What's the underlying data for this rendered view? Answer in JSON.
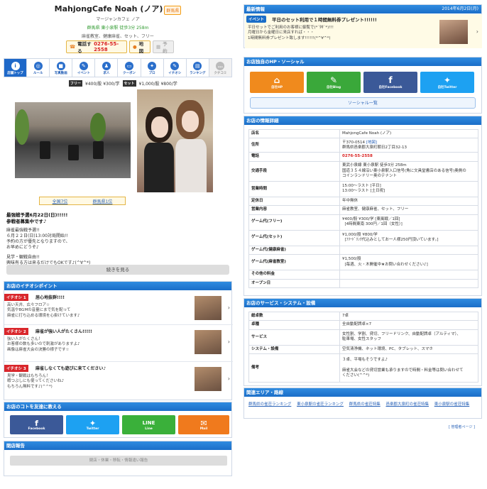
{
  "header": {
    "name": "MahjongCafe Noah (ノア)",
    "area_badge": "群馬県",
    "kana": "マージャンカフェ ノア",
    "address": "群馬県 東小泉駅 徒歩3分 258m",
    "genres": "麻雀教室、健康麻雀、セット、フリー",
    "tel_label": "電話する",
    "tel": "0276-55-2558",
    "map_label": "地図",
    "reserve_label": "予約"
  },
  "nav": [
    {
      "label": "店舗トップ",
      "icon": "i"
    },
    {
      "label": "ルール",
      "icon": "◎"
    },
    {
      "label": "写真動画",
      "icon": "■"
    },
    {
      "label": "イベント",
      "icon": "✎"
    },
    {
      "label": "求人",
      "icon": "♟"
    },
    {
      "label": "クーポン",
      "icon": "▭"
    },
    {
      "label": "プロ",
      "icon": "✦"
    },
    {
      "label": "イチオシ",
      "icon": "✎"
    },
    {
      "label": "ランキング",
      "icon": "▤"
    },
    {
      "label": "クチコミ",
      "icon": "…"
    }
  ],
  "prices": {
    "free_tag": "フリー",
    "free_price": "¥400/股 ¥300/学",
    "set_tag": "セット",
    "set_price": "¥1,000/股 ¥800/学"
  },
  "ranking": {
    "national": "全国7位",
    "prefecture": "群馬県1位"
  },
  "notice": {
    "headline1": "最強戦予選6月22日(日)!!!!!",
    "headline2": "参戦者募集中です♪",
    "line1": "麻雀最強戦予選!!",
    "line2": "６月２２日(日)13:00対局開始!!",
    "line3": "予約の方が優先となりますので、",
    "line4": "お早めにどうぞ♪",
    "line5": "見学・観戦自由!!",
    "line6": "興味有る方は来るだけでもOKです♪(^∀^*)"
  },
  "readmore": "続きを見る",
  "picks": {
    "title": "お店のイチオシポイント",
    "items": [
      {
        "tag": "イチオシ 1",
        "title": "居心地抜群!!!!",
        "line1": "高い天井、広々フロア☆",
        "line2": "気温やBGMの音量にまで気を配って",
        "line3": "麻雀に打ち込める環境を心掛けています♪"
      },
      {
        "tag": "イチオシ 2",
        "title": "麻雀が強い人がたくさん!!!!!",
        "line1": "強い人がたくさん！",
        "line2": "お客様の数も多いので刺激がありますよ♪",
        "line3": "画像は麻雀大会の決勝の様子です☆"
      },
      {
        "tag": "イチオシ 3",
        "title": "麻雀しなくても遊びに来てください♪",
        "line1": "見学・観戦はもちろん！",
        "line2": "暇つぶしにも使ってくださいね♪",
        "line3": "もちろん無料です♪(^^*)"
      }
    ]
  },
  "share": {
    "title": "お店のコトを友達に教える",
    "buttons": [
      "Facebook",
      "Twitter",
      "Line",
      "Mail"
    ]
  },
  "report": {
    "title": "閉店報告",
    "button": "閉店・休業・移転・情報違い報告"
  },
  "news": {
    "title": "最新情報",
    "date": "2014年6月2日(月)",
    "tag": "イベント",
    "headline": "平日のセット利用で１時間無料券プレゼント!!!!!!",
    "line1": "平日セットでご利用のお客様に御覧で(*´艸`*)!!!",
    "line2": "月曜日から金曜日に来店すれば・・・",
    "line3": "1時間無料券プレゼント致します!!!!!!(*^∀^*)"
  },
  "hp": {
    "title": "お店独自のHP・ソーシャル",
    "buttons": [
      "自社HP",
      "自社Blog",
      "自社Facebook",
      "自社Twitter"
    ],
    "list": "ソーシャル一覧"
  },
  "details": {
    "title": "お店の情報詳細",
    "shop_name_k": "店名",
    "shop_name_v": "MahjongCafe Noah (ノア)",
    "addr_k": "住所",
    "addr_v1": "〒370-0514",
    "addr_map": "[地図]",
    "addr_v2": "群馬県邑楽郡大泉町朝日2丁目32-13",
    "tel_k": "電話",
    "tel_v": "0276-55-2558",
    "access_k": "交通手段",
    "access_v1": "東武小泉線 東小泉駅 徒歩3分 258m",
    "access_v2": "国道３５４線沿い東小泉駅入口信号(角に文具堂書店のある信号)奥側の",
    "access_v3": "コインランドリー奥のテナント",
    "hours_k": "営業時間",
    "hours_v1": "15:00〜ラスト [平日]",
    "hours_v2": "13:00〜ラスト [土日祝]",
    "closed_k": "定休日",
    "closed_v": "年中無休",
    "content_k": "営業内容",
    "content_v": "麻雀教室、健康麻雀、セット、フリー",
    "free_k": "ゲーム代(フリー)",
    "free_v1": "¥400/股 ¥300/学 [東風戦／1回]",
    "free_v2": "[4時間東南 300円／1回（女性）]",
    "set_k": "ゲーム代(セット)",
    "set_v1": "¥1,000/股 ¥800/学",
    "set_v2": "[ﾌﾘｰﾄﾞﾘﾝｸ代込みとしてお一人様250円頂いています。]",
    "kenko_k": "ゲーム代(健康麻雀)",
    "kenko_v": "",
    "kyoshitsu_k": "ゲーム代(麻雀教室)",
    "kyoshitsu_v1": "¥1,500/股",
    "kyoshitsu_v2": "[毎週、火・木開催中★お問い合わせください♪]",
    "other_k": "その他の料金",
    "other_v": "",
    "open_k": "オープン日",
    "open_v": ""
  },
  "services": {
    "title": "お店のサービス・システム・設備",
    "tables_k": "総卓数",
    "tables_v": "7卓",
    "table_k": "卓種",
    "table_v": "全自動配牌卓×7",
    "service_k": "サービス",
    "service_v1": "女性割、学割、貸切、フリードリンク、自動配牌卓（アルティマ）、",
    "service_v2": "駐車場、女性スタッフ",
    "system_k": "システム・設備",
    "system_v": "空気清浄機、ネット環境、PC、タブレット、スマホ",
    "note_k": "備考",
    "note_v1": "３卓、平場もそうですよ♪",
    "note_v2": "麻雀大会などの貸切営業も承りますので時間・料金等は問い合わせて",
    "note_v3": "ください(^^*)"
  },
  "areas": {
    "title": "関連エリア・路線",
    "links": [
      "群馬県の雀荘ランキング",
      "東小泉駅の雀荘ランキング",
      "群馬県の雀荘特集",
      "邑楽郡大泉町の雀荘特集",
      "東小泉駅の雀荘特集"
    ]
  },
  "admin_link": "[ 管理者ページ ]",
  "colors": {
    "accent": "#1b6ec8",
    "tel": "#d92020",
    "hp": "#f08a1d",
    "blog": "#3aa83a",
    "facebook": "#3b5998",
    "twitter": "#1da1f2",
    "line": "#3ab03a",
    "mail": "#f07a1d"
  }
}
